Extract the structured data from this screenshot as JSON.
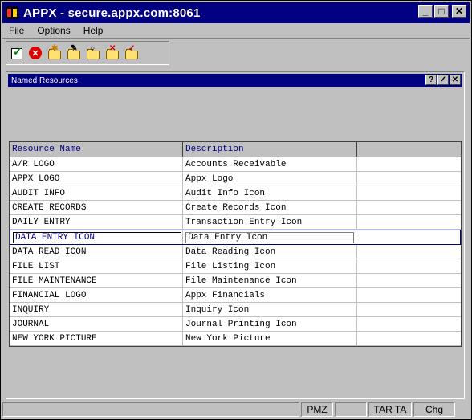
{
  "window": {
    "title": "APPX - secure.appx.com:8061"
  },
  "menu": [
    "File",
    "Options",
    "Help"
  ],
  "toolbar": {
    "icons": [
      "ok-check-icon",
      "cancel-icon",
      "folder-new-icon",
      "folder-edit-icon",
      "folder-search-icon",
      "folder-delete-icon",
      "folder-check-icon"
    ]
  },
  "subwindow": {
    "title": "Named Resources",
    "help": "?",
    "ok": "✓",
    "close": "✕"
  },
  "table": {
    "headers": [
      "Resource Name",
      "Description",
      ""
    ],
    "rows": [
      {
        "name": "A/R LOGO",
        "desc": "Accounts Receivable"
      },
      {
        "name": "APPX LOGO",
        "desc": "Appx Logo"
      },
      {
        "name": "AUDIT INFO",
        "desc": "Audit Info Icon"
      },
      {
        "name": "CREATE RECORDS",
        "desc": "Create Records Icon"
      },
      {
        "name": "DAILY ENTRY",
        "desc": "Transaction Entry Icon"
      },
      {
        "name": "DATA ENTRY ICON",
        "desc": "Data Entry Icon"
      },
      {
        "name": "DATA READ ICON",
        "desc": "Data Reading Icon"
      },
      {
        "name": "FILE LIST",
        "desc": "File Listing Icon"
      },
      {
        "name": "FILE MAINTENANCE",
        "desc": "File Maintenance Icon"
      },
      {
        "name": "FINANCIAL LOGO",
        "desc": "Appx Financials"
      },
      {
        "name": "INQUIRY",
        "desc": "Inquiry Icon"
      },
      {
        "name": "JOURNAL",
        "desc": "Journal Printing Icon"
      },
      {
        "name": "NEW YORK PICTURE",
        "desc": "New York Picture"
      }
    ]
  },
  "status": {
    "p1": "",
    "p2": "PMZ",
    "p3": "",
    "p4": "TAR TA",
    "p5": "Chg"
  }
}
